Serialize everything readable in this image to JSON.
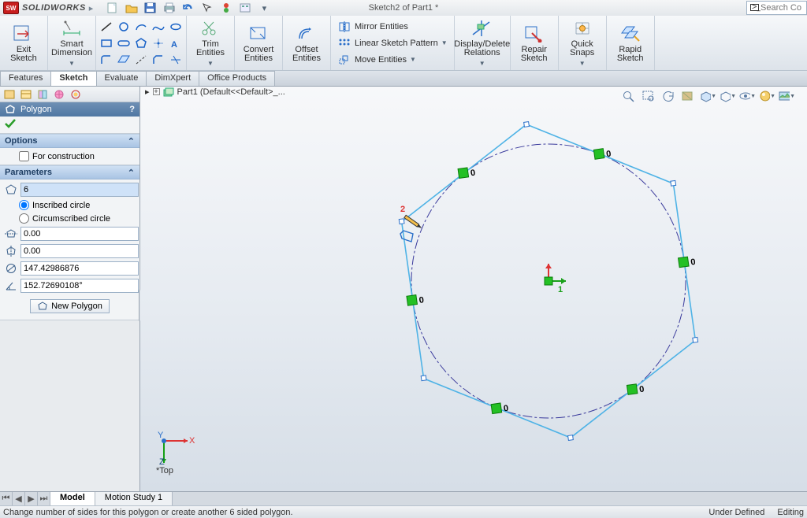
{
  "app_brand_1": "SOLID",
  "app_brand_2": "WORKS",
  "document_title": "Sketch2 of Part1 *",
  "search": {
    "placeholder": "Search Co"
  },
  "ribbon": {
    "exit_sketch": "Exit\nSketch",
    "smart_dimension": "Smart\nDimension",
    "trim": "Trim\nEntities",
    "convert": "Convert\nEntities",
    "offset": "Offset\nEntities",
    "mirror": "Mirror Entities",
    "pattern": "Linear Sketch Pattern",
    "move": "Move Entities",
    "dispdel": "Display/Delete\nRelations",
    "repair": "Repair\nSketch",
    "quick": "Quick\nSnaps",
    "rapid": "Rapid\nSketch"
  },
  "tabs": {
    "features": "Features",
    "sketch": "Sketch",
    "evaluate": "Evaluate",
    "dimxpert": "DimXpert",
    "office": "Office Products"
  },
  "feature_tree": {
    "root": "Part1 (Default<<Default>_..."
  },
  "pm": {
    "title": "Polygon",
    "help": "?",
    "options_head": "Options",
    "for_construction": "For construction",
    "params_head": "Parameters",
    "sides": "6",
    "inscribed": "Inscribed circle",
    "circumscribed": "Circumscribed circle",
    "cx": "0.00",
    "cy": "0.00",
    "diameter": "147.42986876",
    "angle": "152.72690108°",
    "new_polygon": "New Polygon"
  },
  "graphics": {
    "origin_label_1": "1",
    "origin_annot_2": "2",
    "relation_badge": "0"
  },
  "viewlabel": "*Top",
  "bottom_tabs": {
    "model": "Model",
    "motion": "Motion Study 1"
  },
  "status": {
    "hint": "Change number of sides for this polygon or create another 6 sided polygon.",
    "under_defined": "Under Defined",
    "editing": "Editing"
  }
}
